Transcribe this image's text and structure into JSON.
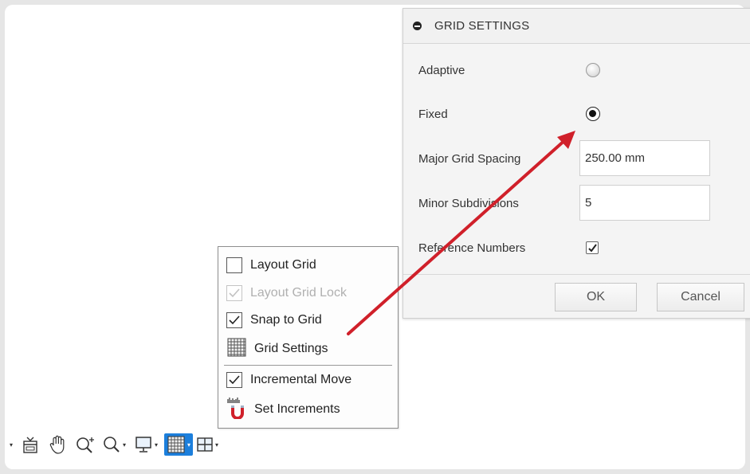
{
  "dialog": {
    "title": "GRID SETTINGS",
    "adaptive_label": "Adaptive",
    "adaptive_selected": false,
    "fixed_label": "Fixed",
    "fixed_selected": true,
    "major_spacing_label": "Major Grid Spacing",
    "major_spacing_value": "250.00 mm",
    "minor_subdivisions_label": "Minor Subdivisions",
    "minor_subdivisions_value": "5",
    "reference_numbers_label": "Reference Numbers",
    "reference_numbers_checked": true,
    "ok_label": "OK",
    "cancel_label": "Cancel"
  },
  "menu": {
    "items": [
      {
        "label": "Layout Grid",
        "checked": false,
        "enabled": true
      },
      {
        "label": "Layout Grid Lock",
        "checked": true,
        "enabled": false
      },
      {
        "label": "Snap to Grid",
        "checked": true,
        "enabled": true
      },
      {
        "label": "Grid Settings",
        "icon": "grid-icon"
      },
      {
        "label": "Incremental Move",
        "checked": true,
        "enabled": true
      },
      {
        "label": "Set Increments",
        "icon": "magnet-icon"
      }
    ]
  },
  "toolbar": {
    "tools": [
      "orbit-icon",
      "look-at-icon",
      "pan-hand-icon",
      "zoom-icon",
      "fit-icon",
      "display-settings-icon",
      "grid-snaps-icon",
      "viewports-icon"
    ],
    "active_tool": "grid-snaps-icon"
  },
  "colors": {
    "annotation_arrow": "#d0202a",
    "active_tool_bg": "#1c7fdc"
  }
}
